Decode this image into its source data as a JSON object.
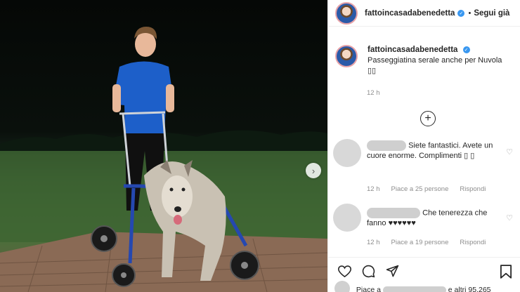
{
  "post": {
    "username": "fattoincasadabenedetta",
    "header_follow_separator": "•",
    "follow_label": "Segui già",
    "caption_text": "Passeggiatina serale anche per Nuvola",
    "caption_emoji": "▯▯",
    "caption_time": "12 h",
    "verified_icon": "verified-badge-icon",
    "accent_color": "#3897f0"
  },
  "comments": [
    {
      "text": "Siete fantastici. Avete un cuore enorme. Complimenti ▯ ▯",
      "time": "12 h",
      "likes": "Piace a 25 persone",
      "reply": "Rispondi"
    },
    {
      "text": "Che tenerezza che fanno ♥♥♥♥♥♥",
      "time": "12 h",
      "likes": "Piace a 19 persone",
      "reply": "Rispondi"
    }
  ],
  "likes_summary": {
    "prefix": "Piace a",
    "suffix": "e altri 95.265"
  },
  "icons": {
    "load_more": "plus-circle-icon",
    "next": "chevron-right-icon",
    "like": "heart-icon",
    "comment": "comment-bubble-icon",
    "share": "paper-plane-icon",
    "save": "bookmark-icon"
  }
}
